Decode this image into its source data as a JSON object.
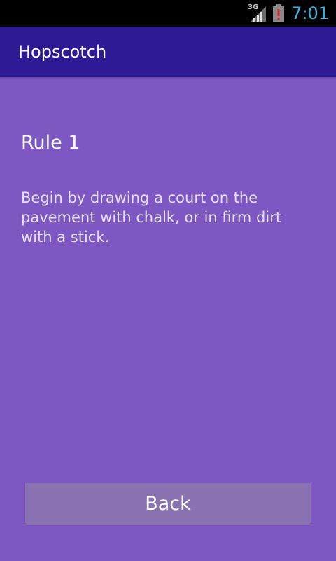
{
  "status_bar": {
    "network_type": "3G",
    "time": "7:01",
    "icons": [
      "signal-icon",
      "battery-alert-icon"
    ],
    "clock_color": "#33b5e5"
  },
  "action_bar": {
    "title": "Hopscotch",
    "background_color": "#2f1a95"
  },
  "content": {
    "rule_title": "Rule 1",
    "rule_text": "Begin by drawing a court on the pavement with chalk, or in firm dirt with a stick.",
    "background_color": "#7d57c2"
  },
  "back_button": {
    "label": "Back",
    "background_color": "#8a71b0"
  }
}
